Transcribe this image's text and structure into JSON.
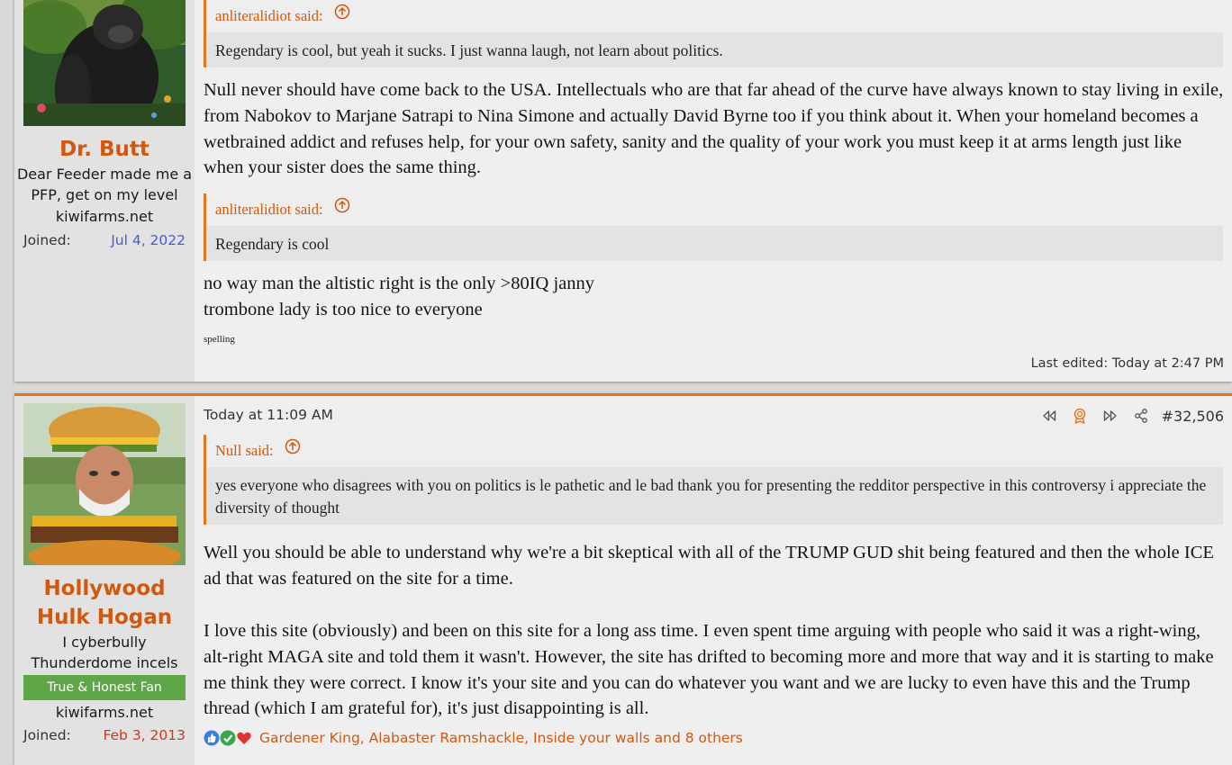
{
  "posts": [
    {
      "user": {
        "name": "Dr. Butt",
        "title_lines": [
          "Dear Feeder made me a",
          "PFP, get on my level"
        ],
        "site": "kiwifarms.net",
        "joined_label": "Joined:",
        "joined_date": "Jul 4, 2022"
      },
      "quotes": [
        {
          "author": "anliteralidiot said:",
          "text": "Regendary is cool, but yeah it sucks. I just wanna laugh, not learn about politics."
        },
        {
          "author": "anliteralidiot said:",
          "text": "Regendary is cool"
        }
      ],
      "paragraphs": [
        "Null never should have come back to the USA. Intellectuals who are that far ahead of the curve have always known to stay living in exile, from Nabokov to Marjane Satrapi to Nina Simone and actually David Byrne too if you think about it. When your homeland becomes a wetbrained addict and refuses help, for your own safety, sanity and the quality of your work you must keep it at arms length just like when your sister does the same thing."
      ],
      "reply_lines": [
        "no way man the altistic right is the only >80IQ janny",
        "trombone lady is too nice to everyone"
      ],
      "edit_note": "spelling",
      "last_edited": "Last edited: Today at 2:47 PM"
    },
    {
      "user": {
        "name": "Hollywood Hulk Hogan",
        "title_lines": [
          "I cyberbully",
          "Thunderdome incels"
        ],
        "banner": "True & Honest Fan",
        "site": "kiwifarms.net",
        "joined_label": "Joined:",
        "joined_date": "Feb 3, 2013"
      },
      "date": "Today at 11:09 AM",
      "post_number": "#32,506",
      "quotes": [
        {
          "author": "Null said:",
          "text": "yes everyone who disagrees with you on politics is le pathetic and le bad thank you for presenting the redditor perspective in this controversy i appreciate the diversity of thought"
        }
      ],
      "paragraphs": [
        "Well you should be able to understand why we're a bit skeptical with all of the TRUMP GUD shit being featured and then the whole ICE ad that was featured on the site for a time.",
        "I love this site (obviously) and been on this site for a long ass time. I even spent time arguing with people who said it was a right-wing, alt-right MAGA site and told them it wasn't. However, the site has drifted to becoming more and more that way and it is starting to make me think they were correct. I know it's your site and you can do whatever you want and we are lucky to even have this and the Trump thread (which I am grateful for), it's just disappointing is all."
      ],
      "reactions": "Gardener King, Alabaster Ramshackle, Inside your walls and 8 others"
    }
  ],
  "colors": {
    "accent": "#d2580e",
    "bar": "#e8741b",
    "joined_blue": "#4a5bd0",
    "joined_red": "#cc3b1e",
    "banner": "#5fa649"
  }
}
